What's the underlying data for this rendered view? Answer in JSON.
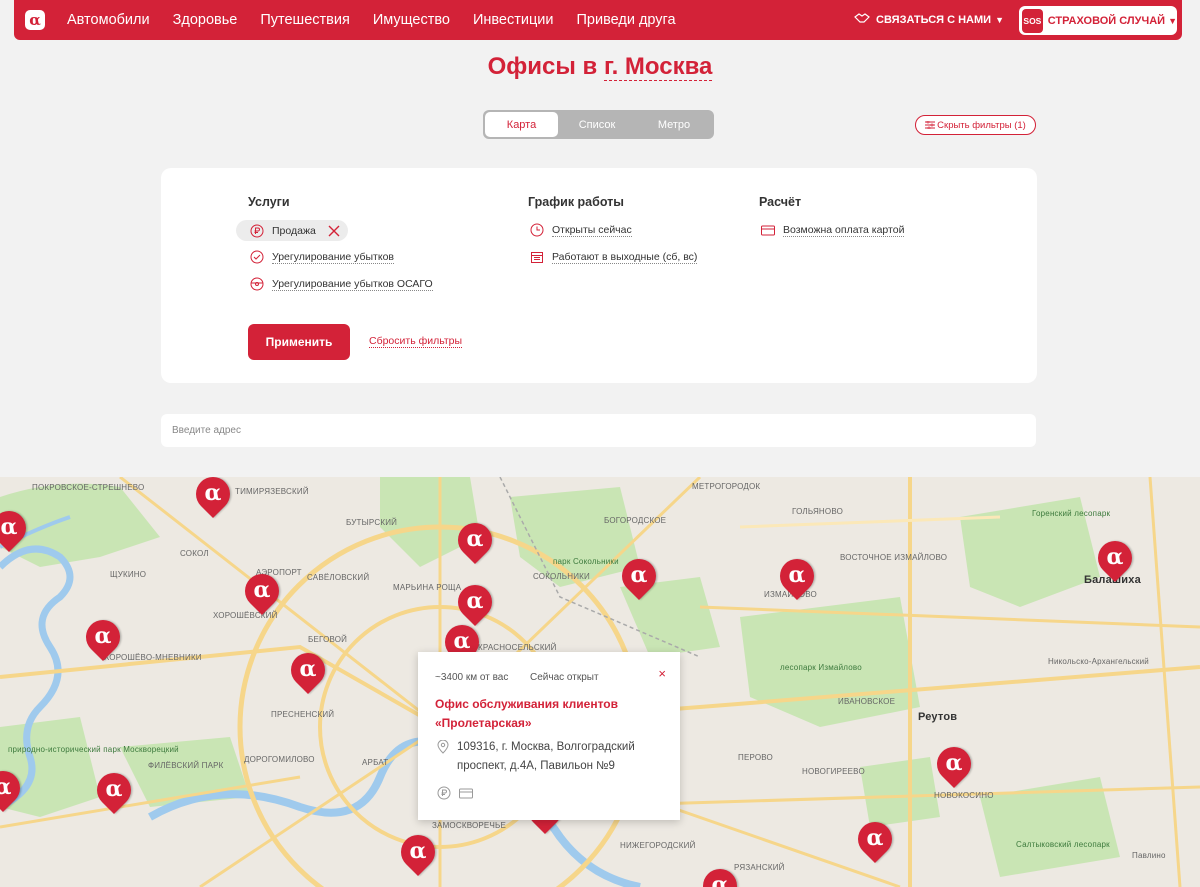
{
  "header": {
    "logo": "α",
    "nav": [
      "Автомобили",
      "Здоровье",
      "Путешествия",
      "Имущество",
      "Инвестиции",
      "Приведи друга"
    ],
    "contact_label": "СВЯЗАТЬСЯ С НАМИ",
    "sos_badge": "SOS",
    "sos_label": "СТРАХОВОЙ СЛУЧАЙ"
  },
  "page": {
    "title_prefix": "Офисы в",
    "title_city": "г. Москва"
  },
  "tabs": [
    {
      "label": "Карта",
      "active": true
    },
    {
      "label": "Список",
      "active": false
    },
    {
      "label": "Метро",
      "active": false
    }
  ],
  "hide_filters_label": "Скрыть фильтры (1)",
  "filters": {
    "services": {
      "heading": "Услуги",
      "items": [
        "Продажа",
        "Урегулирование убытков",
        "Урегулирование убытков ОСАГО"
      ]
    },
    "schedule": {
      "heading": "График работы",
      "items": [
        "Открыты сейчас",
        "Работают в выходные (сб, вс)"
      ]
    },
    "payment": {
      "heading": "Расчёт",
      "items": [
        "Возможна оплата картой"
      ]
    },
    "apply_label": "Применить",
    "reset_label": "Сбросить фильтры"
  },
  "address": {
    "placeholder": "Введите адрес",
    "value": ""
  },
  "map": {
    "labels": [
      "ПОКРОВСКОЕ-СТРЕШНЕВО",
      "ТИМИРЯЗЕВСКИЙ",
      "БУТЫРСКИЙ",
      "МЕТРОГОРОДОК",
      "ГОЛЬЯНОВО",
      "БОГОРОДСКОЕ",
      "парк Сокольники",
      "СОКОЛЬНИКИ",
      "СОКОЛ",
      "АЭРОПОРТ",
      "САВЁЛОВСКИЙ",
      "МАРЬИНА РОЩА",
      "ЩУКИНО",
      "ХОРОШЁВСКИЙ",
      "БЕГОВОЙ",
      "КРАСНОСЕЛЬСКИЙ",
      "ВОСТОЧНОЕ ИЗМАЙЛОВО",
      "ИЗМАЙЛОВО",
      "ХОРОШЁВО-МНЕВНИКИ",
      "ПРЕСНЕНСКИЙ",
      "АРБАТ",
      "лесопарк Измайлово",
      "ИВАНОВСКОЕ",
      "Реутов",
      "Балашиха",
      "Никольско-Архангельский",
      "природно-исторический парк Москворецкий",
      "ФИЛЁВСКИЙ ПАРК",
      "ДОРОГОМИЛОВО",
      "ПЕРОВО",
      "НОВОГИРЕЕВО",
      "НОВОКОСИНО",
      "ЗАМОСКВОРЕЧЬЕ",
      "НИЖЕГОРОДСКИЙ",
      "РЯЗАНСКИЙ",
      "Павлино",
      "Горенский лесопарк",
      "Салтыковский лесопарк"
    ],
    "pins": 20
  },
  "popup": {
    "distance": "~3400 км от вас",
    "status": "Сейчас открыт",
    "close": "×",
    "name": "Офис обслуживания клиентов «Пролетарская»",
    "address": "109316, г. Москва, Волгоградский проспект, д.4А, Павильон №9"
  },
  "colors": {
    "brand": "#d32238",
    "page_bg": "#f2f2f2",
    "map_bg": "#ede9e2",
    "park": "#c9e5b4",
    "water": "#9fcaed"
  },
  "icons": [
    "logo-alpha-icon",
    "handshake-icon",
    "chevron-down-icon",
    "ruble-icon",
    "check-icon",
    "wheel-icon",
    "clock-icon",
    "calendar-icon",
    "card-icon",
    "close-icon",
    "location-icon",
    "filter-sliders-icon"
  ]
}
